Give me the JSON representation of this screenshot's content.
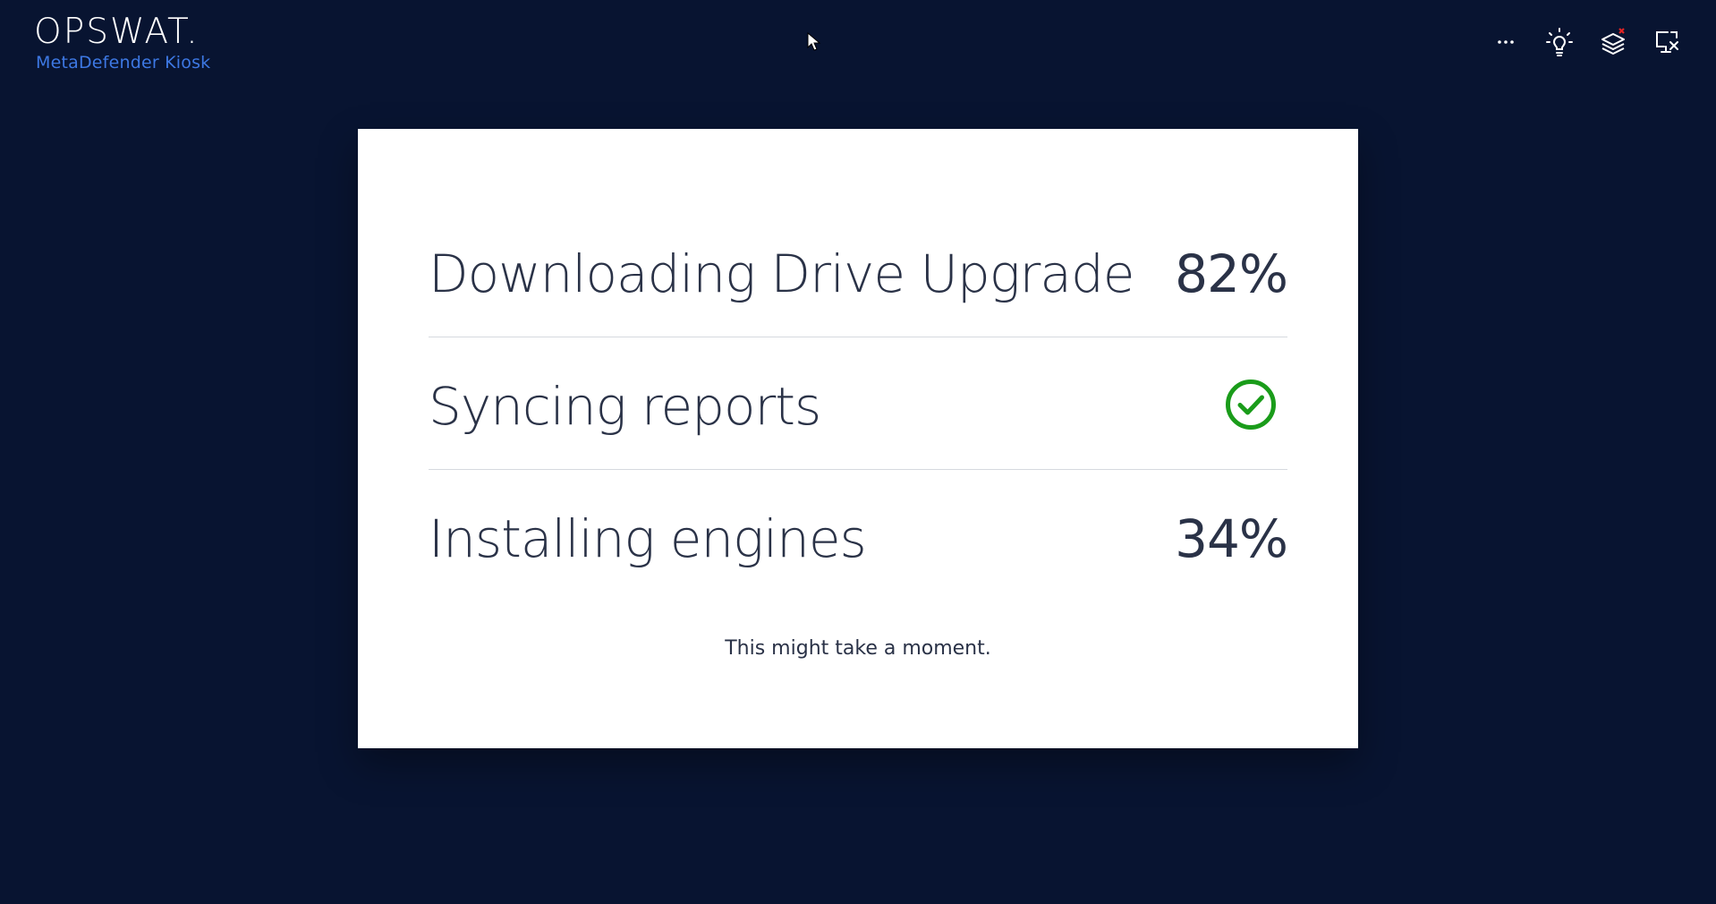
{
  "brand": {
    "logo_text": "OPSWAT.",
    "product_name": "MetaDefender Kiosk"
  },
  "toolbar": {
    "icons": [
      "more-icon",
      "lightbulb-icon",
      "layers-error-icon",
      "network-disconnected-icon"
    ],
    "more_label": "···"
  },
  "progress": {
    "items": [
      {
        "label": "Downloading Drive Upgrade",
        "value": "82%",
        "percent": 82,
        "status": "in-progress"
      },
      {
        "label": "Syncing reports",
        "value": "",
        "status": "complete"
      },
      {
        "label": "Installing engines",
        "value": "34%",
        "percent": 34,
        "status": "in-progress"
      }
    ],
    "note": "This might take a moment."
  },
  "colors": {
    "background": "#081431",
    "brand_blue": "#3d78e3",
    "success_green": "#1a9c1a",
    "error_red": "#e02424",
    "text_dark": "#2a3247"
  }
}
